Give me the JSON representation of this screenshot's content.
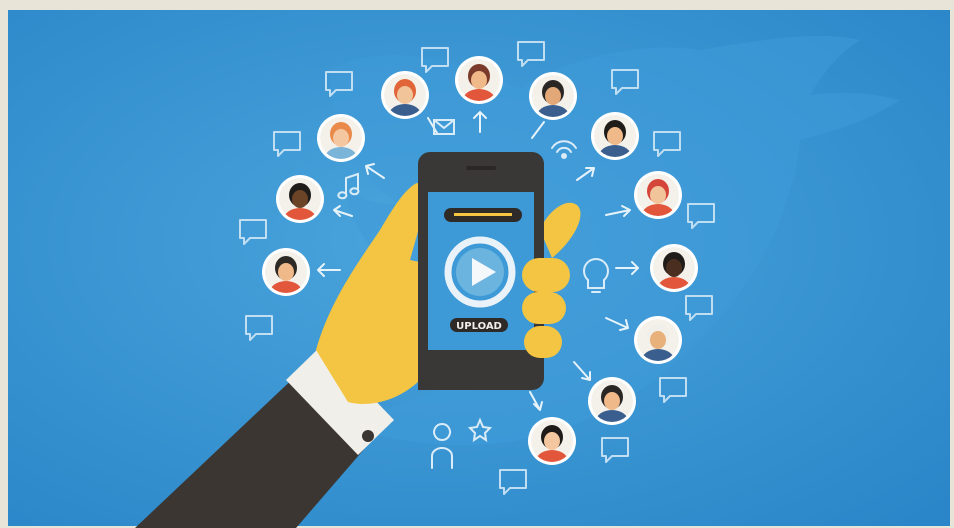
{
  "image": {
    "description_labels": {
      "upload_label": "UPLOAD"
    },
    "colors": {
      "border": "#e9e4d8",
      "background_blue": "#2f8fd0",
      "background_blue_light": "#4aa4dc",
      "bird_silhouette": "#3f9ad8",
      "phone_body": "#3a3836",
      "phone_screen": "#3d9ad6",
      "hand": "#f3c542",
      "sleeve": "#3b3632",
      "cuff": "#f1efe9",
      "icon_line": "#cfe6f6",
      "avatar_ring": "#ffffff"
    },
    "avatars": [
      {
        "name": "avatar-top-center",
        "skin": "#f0b98a",
        "hair": "#7a3b2a",
        "shirt": "#e2573b"
      },
      {
        "name": "avatar-top-left",
        "skin": "#f2c49a",
        "hair": "#e0663a",
        "shirt": "#3a5f8f"
      },
      {
        "name": "avatar-upper-left",
        "skin": "#f4c7a0",
        "hair": "#e98a4a",
        "shirt": "#7ab4d8"
      },
      {
        "name": "avatar-left",
        "skin": "#6b4428",
        "hair": "#1f1b18",
        "shirt": "#e2573b"
      },
      {
        "name": "avatar-lower-left",
        "skin": "#f0b98a",
        "hair": "#2d2a26",
        "shirt": "#e2573b"
      },
      {
        "name": "avatar-top-right",
        "skin": "#e3a877",
        "hair": "#2a2624",
        "shirt": "#3a5f8f"
      },
      {
        "name": "avatar-upper-right",
        "skin": "#f0b98a",
        "hair": "#1f1b18",
        "shirt": "#3a5f8f"
      },
      {
        "name": "avatar-right-upper",
        "skin": "#f2c49a",
        "hair": "#d5463a",
        "shirt": "#e2573b"
      },
      {
        "name": "avatar-right",
        "skin": "#4a2f20",
        "hair": "#1f1b18",
        "shirt": "#e2573b"
      },
      {
        "name": "avatar-right-lower",
        "skin": "#e8b07a",
        "hair": "#f1efe9",
        "shirt": "#3a5f8f"
      },
      {
        "name": "avatar-lower-right",
        "skin": "#f0b98a",
        "hair": "#2a2624",
        "shirt": "#3a5f8f"
      },
      {
        "name": "avatar-bottom",
        "skin": "#f4c7a0",
        "hair": "#1f1b18",
        "shirt": "#e2573b"
      }
    ]
  }
}
